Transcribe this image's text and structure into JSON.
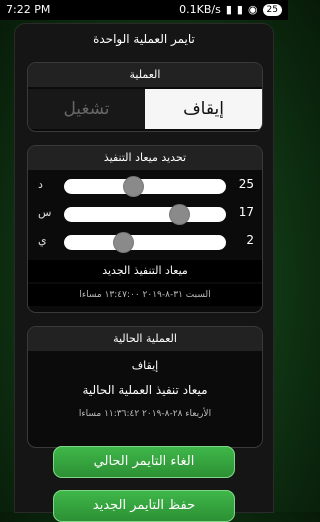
{
  "statusbar": {
    "time": "7:22 PM",
    "net_speed": "0.1KB/s",
    "battery": "25"
  },
  "app": {
    "title": "تايمر العملية الواحدة"
  },
  "operation": {
    "header": "العملية",
    "run_label": "تشغيل",
    "stop_label": "إيقاف",
    "selected": "stop"
  },
  "schedule": {
    "header": "تحديد ميعاد التنفيذ",
    "rows": [
      {
        "unit": "د",
        "value": "25",
        "fraction": 0.42
      },
      {
        "unit": "س",
        "value": "17",
        "fraction": 0.74
      },
      {
        "unit": "ي",
        "value": "2",
        "fraction": 0.35
      }
    ],
    "new_label": "ميعاد التنفيذ الجديد",
    "new_date": "السبت ٣١-٨-٢٠١٩ ١٣:٤٧:٠٠ مساءا"
  },
  "current": {
    "header": "العملية الحالية",
    "operation": "إيقاف",
    "time_label": "ميعاد تنفيذ العملية الحالية",
    "time_value": "الأربعاء ٢٨-٨-٢٠١٩ ١١:٣٦:٤٢ مساءا"
  },
  "buttons": {
    "cancel": "الغاء التايمر الحالي",
    "save": "حفظ التايمر الجديد"
  }
}
